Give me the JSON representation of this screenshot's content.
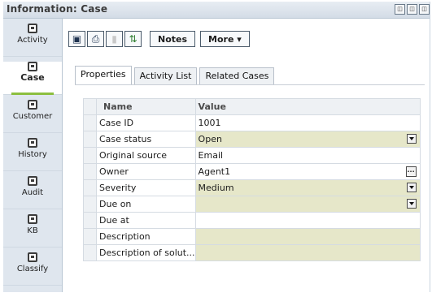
{
  "window": {
    "title": "Information: Case",
    "buttons": [
      "◫",
      "◫",
      "◫"
    ]
  },
  "sidebar": {
    "items": [
      {
        "label": "Activity",
        "icon": "activity-icon"
      },
      {
        "label": "Case",
        "icon": "case-icon",
        "active": true
      },
      {
        "label": "Customer",
        "icon": "customer-icon"
      },
      {
        "label": "History",
        "icon": "history-icon"
      },
      {
        "label": "Audit",
        "icon": "audit-icon"
      },
      {
        "label": "KB",
        "icon": "kb-icon"
      },
      {
        "label": "Classify",
        "icon": "classify-icon"
      }
    ]
  },
  "toolbar": {
    "icons": [
      "save-icon",
      "print-icon",
      "attach-icon",
      "swap-icon"
    ],
    "notes_label": "Notes",
    "more_label": "More ▾"
  },
  "tabs": [
    {
      "label": "Properties",
      "active": true
    },
    {
      "label": "Activity List"
    },
    {
      "label": "Related Cases"
    }
  ],
  "grid": {
    "headers": {
      "name": "Name",
      "value": "Value"
    },
    "rows": [
      {
        "name": "Case ID",
        "value": "1001",
        "highlight": false,
        "control": ""
      },
      {
        "name": "Case status",
        "value": "Open",
        "highlight": true,
        "control": "dropdown"
      },
      {
        "name": "Original source",
        "value": "Email",
        "highlight": false,
        "control": ""
      },
      {
        "name": "Owner",
        "value": "Agent1",
        "highlight": false,
        "control": "ellipsis"
      },
      {
        "name": "Severity",
        "value": "Medium",
        "highlight": true,
        "control": "dropdown"
      },
      {
        "name": "Due on",
        "value": "",
        "highlight": true,
        "control": "dropdown"
      },
      {
        "name": "Due at",
        "value": "",
        "highlight": false,
        "control": ""
      },
      {
        "name": "Description",
        "value": "",
        "highlight": true,
        "control": ""
      },
      {
        "name": "Description of solut...",
        "value": "",
        "highlight": true,
        "control": ""
      }
    ]
  }
}
